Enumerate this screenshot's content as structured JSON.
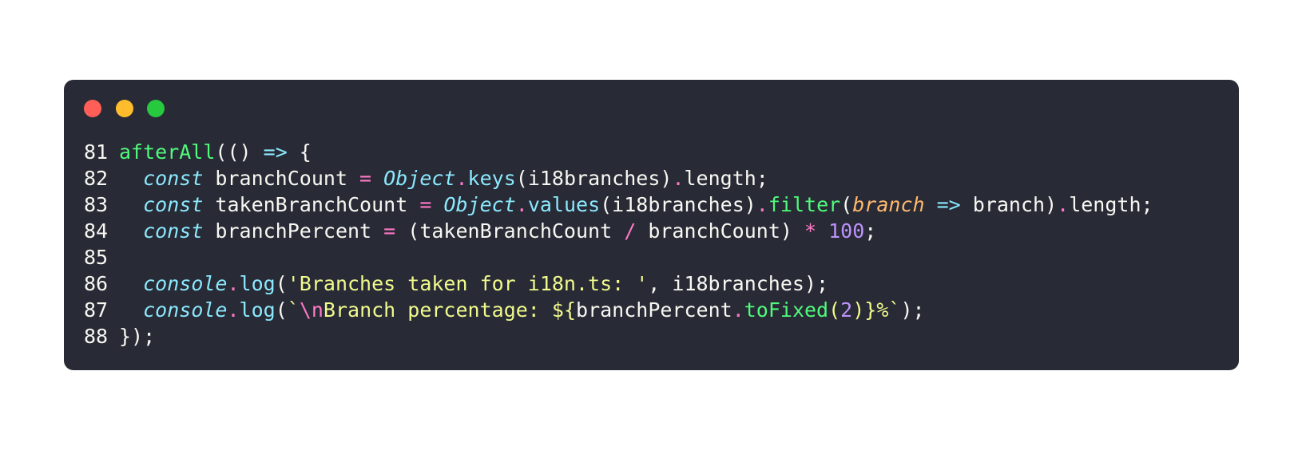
{
  "window": {
    "dots": [
      {
        "name": "close",
        "color": "#ff5f56"
      },
      {
        "name": "minimize",
        "color": "#ffbd2e"
      },
      {
        "name": "maximize",
        "color": "#27c93f"
      }
    ]
  },
  "code": {
    "lines": [
      {
        "n": "81",
        "tokens": [
          {
            "t": "afterAll",
            "c": "fn"
          },
          {
            "t": "(() ",
            "c": "plain"
          },
          {
            "t": "=>",
            "c": "arrow"
          },
          {
            "t": " {",
            "c": "plain"
          }
        ]
      },
      {
        "n": "82",
        "tokens": [
          {
            "t": "  ",
            "c": "plain"
          },
          {
            "t": "const",
            "c": "kw"
          },
          {
            "t": " branchCount ",
            "c": "plain"
          },
          {
            "t": "=",
            "c": "op"
          },
          {
            "t": " ",
            "c": "plain"
          },
          {
            "t": "Object",
            "c": "obj"
          },
          {
            "t": ".",
            "c": "op"
          },
          {
            "t": "keys",
            "c": "prop"
          },
          {
            "t": "(i18branches)",
            "c": "plain"
          },
          {
            "t": ".",
            "c": "op"
          },
          {
            "t": "length;",
            "c": "plain"
          }
        ]
      },
      {
        "n": "83",
        "tokens": [
          {
            "t": "  ",
            "c": "plain"
          },
          {
            "t": "const",
            "c": "kw"
          },
          {
            "t": " takenBranchCount ",
            "c": "plain"
          },
          {
            "t": "=",
            "c": "op"
          },
          {
            "t": " ",
            "c": "plain"
          },
          {
            "t": "Object",
            "c": "obj"
          },
          {
            "t": ".",
            "c": "op"
          },
          {
            "t": "values",
            "c": "prop"
          },
          {
            "t": "(i18branches)",
            "c": "plain"
          },
          {
            "t": ".",
            "c": "op"
          },
          {
            "t": "filter",
            "c": "method"
          },
          {
            "t": "(",
            "c": "plain"
          },
          {
            "t": "branch",
            "c": "param"
          },
          {
            "t": " ",
            "c": "plain"
          },
          {
            "t": "=>",
            "c": "arrow"
          },
          {
            "t": " branch)",
            "c": "plain"
          },
          {
            "t": ".",
            "c": "op"
          },
          {
            "t": "length;",
            "c": "plain"
          }
        ]
      },
      {
        "n": "84",
        "tokens": [
          {
            "t": "  ",
            "c": "plain"
          },
          {
            "t": "const",
            "c": "kw"
          },
          {
            "t": " branchPercent ",
            "c": "plain"
          },
          {
            "t": "=",
            "c": "op"
          },
          {
            "t": " (takenBranchCount ",
            "c": "plain"
          },
          {
            "t": "/",
            "c": "op"
          },
          {
            "t": " branchCount) ",
            "c": "plain"
          },
          {
            "t": "*",
            "c": "op"
          },
          {
            "t": " ",
            "c": "plain"
          },
          {
            "t": "100",
            "c": "num"
          },
          {
            "t": ";",
            "c": "plain"
          }
        ]
      },
      {
        "n": "85",
        "tokens": []
      },
      {
        "n": "86",
        "tokens": [
          {
            "t": "  ",
            "c": "plain"
          },
          {
            "t": "console",
            "c": "obj"
          },
          {
            "t": ".",
            "c": "op"
          },
          {
            "t": "log",
            "c": "prop"
          },
          {
            "t": "(",
            "c": "plain"
          },
          {
            "t": "'Branches taken for i18n.ts: '",
            "c": "str"
          },
          {
            "t": ", i18branches);",
            "c": "plain"
          }
        ]
      },
      {
        "n": "87",
        "tokens": [
          {
            "t": "  ",
            "c": "plain"
          },
          {
            "t": "console",
            "c": "obj"
          },
          {
            "t": ".",
            "c": "op"
          },
          {
            "t": "log",
            "c": "prop"
          },
          {
            "t": "(",
            "c": "plain"
          },
          {
            "t": "`",
            "c": "str"
          },
          {
            "t": "\\n",
            "c": "op"
          },
          {
            "t": "Branch percentage: ",
            "c": "str"
          },
          {
            "t": "${",
            "c": "str"
          },
          {
            "t": "branchPercent",
            "c": "plain"
          },
          {
            "t": ".",
            "c": "op"
          },
          {
            "t": "toFixed",
            "c": "method"
          },
          {
            "t": "(",
            "c": "str"
          },
          {
            "t": "2",
            "c": "num"
          },
          {
            "t": ")",
            "c": "str"
          },
          {
            "t": "}%`",
            "c": "str"
          },
          {
            "t": ");",
            "c": "plain"
          }
        ]
      },
      {
        "n": "88",
        "tokens": [
          {
            "t": "});",
            "c": "plain"
          }
        ]
      }
    ]
  }
}
